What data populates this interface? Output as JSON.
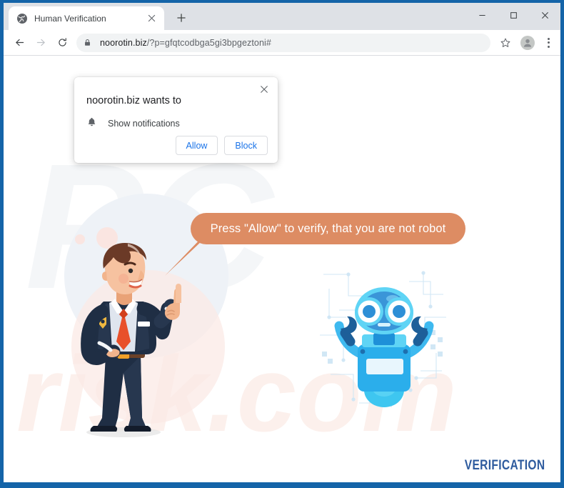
{
  "window": {
    "controls": {
      "minimize": "minimize-icon",
      "maximize": "maximize-icon",
      "close": "close-icon"
    }
  },
  "tabs": [
    {
      "title": "Human Verification",
      "favicon": "globe-icon",
      "close": "close-icon",
      "active": true
    }
  ],
  "newtab_label": "+",
  "toolbar": {
    "back": "back-arrow-icon",
    "forward": "forward-arrow-icon",
    "reload": "reload-icon",
    "lock": "lock-icon",
    "url_host": "noorotin.biz",
    "url_path": "/?p=gfqtcodbga5gi3bpgeztoni#",
    "url_full": "noorotin.biz/?p=gfqtcodbga5gi3bpgeztoni#",
    "bookmark": "star-icon",
    "profile": "profile-avatar-icon",
    "menu": "kebab-menu-icon"
  },
  "permission_dialog": {
    "title": "noorotin.biz wants to",
    "permission_icon": "bell-icon",
    "permission_label": "Show notifications",
    "allow_label": "Allow",
    "block_label": "Block",
    "close_label": "×"
  },
  "page": {
    "bubble_text": "Press \"Allow\" to verify, that you are not robot",
    "footer_text": "VERIFICATION",
    "watermark_top": "PC",
    "watermark_bottom": "risk.com",
    "man_illustration": "businessman-pointing-illustration",
    "robot_illustration": "blue-robot-illustration"
  },
  "colors": {
    "window_frame": "#1464a8",
    "tabstrip": "#dee1e6",
    "bubble": "#dd8c63",
    "link_blue": "#1a73e8",
    "footer_blue": "#2e5b9e",
    "robot_blue": "#29b6ef",
    "suit_navy": "#1f2e44",
    "tie_orange": "#e8502a"
  }
}
